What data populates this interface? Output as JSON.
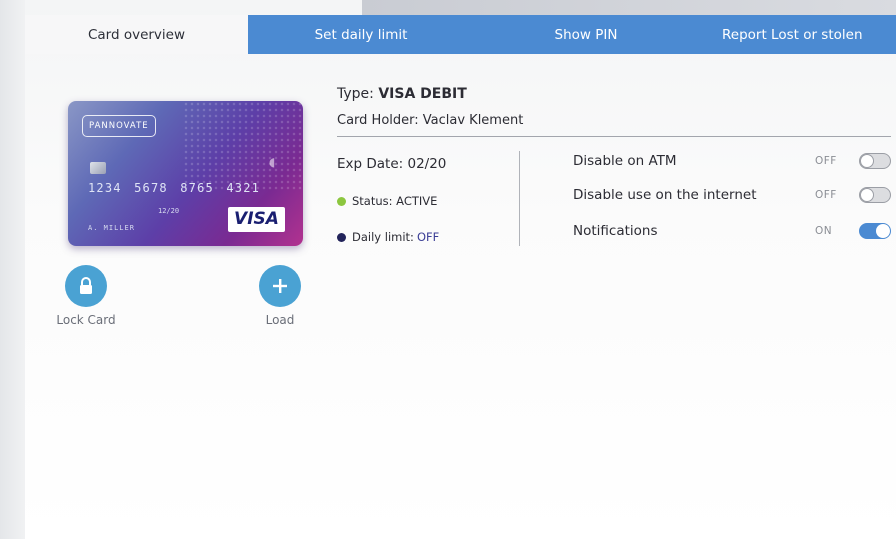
{
  "tabs": [
    {
      "label": "Card overview",
      "active": true
    },
    {
      "label": "Set daily limit",
      "active": false
    },
    {
      "label": "Show PIN",
      "active": false
    },
    {
      "label": "Report Lost or stolen",
      "active": false
    }
  ],
  "card": {
    "brand_logo": "PANNOVATE",
    "number": "1234 5678 8765 4321",
    "expiry": "12/20",
    "name": "A. MILLER",
    "network": "VISA"
  },
  "actions": {
    "lock_label": "Lock Card",
    "lock_icon": "lock-icon",
    "load_label": "Load",
    "load_icon": "plus-icon"
  },
  "details": {
    "type_label": "Type:",
    "type_value": "VISA DEBIT",
    "holder": "Card Holder: Vaclav Klement",
    "exp": "Exp Date: 02/20",
    "status": "Status: ACTIVE",
    "limit_label": "Daily limit:",
    "limit_value": "OFF"
  },
  "settings": [
    {
      "label": "Disable on ATM",
      "state": "OFF"
    },
    {
      "label": "Disable use on the internet",
      "state": "OFF"
    },
    {
      "label": "Notifications",
      "state": "ON"
    }
  ],
  "colors": {
    "accent": "#4b8ad2",
    "action": "#4aa2d3",
    "status_active": "#8cc63f",
    "limit_dot": "#22235a"
  }
}
